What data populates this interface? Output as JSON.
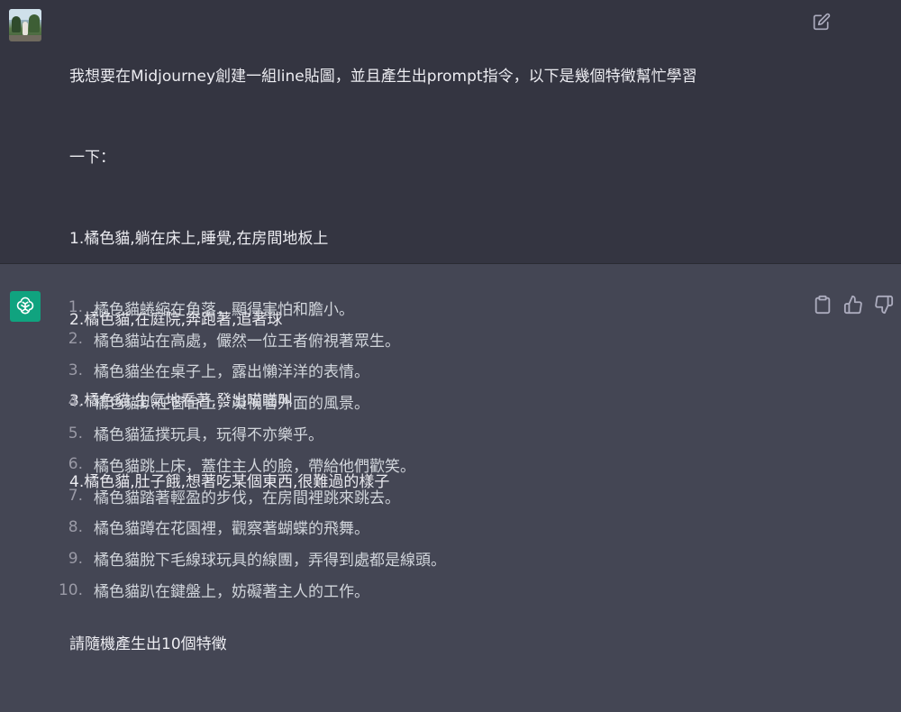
{
  "user_message": {
    "lines": [
      "我想要在Midjourney創建一組line貼圖，並且產生出prompt指令，以下是幾個特徵幫忙學習",
      "一下：",
      "1.橘色貓,躺在床上,睡覺,在房間地板上",
      "2.橘色貓,在庭院,奔跑著,追著球",
      "3.橘色貓,生氣地看著,發出喵喵叫",
      "4.橘色貓,肚子餓,想著吃某個東西,很難過的樣子",
      "請隨機產生出10個特徵"
    ],
    "edit_icon": "pencil-square-icon"
  },
  "assistant_message": {
    "logo_icon": "openai-logo-icon",
    "items": [
      {
        "num": "1.",
        "text": "橘色貓蜷縮在角落，顯得害怕和膽小。"
      },
      {
        "num": "2.",
        "text": "橘色貓站在高處，儼然一位王者俯視著眾生。"
      },
      {
        "num": "3.",
        "text": "橘色貓坐在桌子上，露出懶洋洋的表情。"
      },
      {
        "num": "4.",
        "text": "橘色貓趴在窗台上，凝視著外面的風景。"
      },
      {
        "num": "5.",
        "text": "橘色貓猛撲玩具，玩得不亦樂乎。"
      },
      {
        "num": "6.",
        "text": "橘色貓跳上床，蓋住主人的臉，帶給他們歡笑。"
      },
      {
        "num": "7.",
        "text": "橘色貓踏著輕盈的步伐，在房間裡跳來跳去。"
      },
      {
        "num": "8.",
        "text": "橘色貓蹲在花園裡，觀察著蝴蝶的飛舞。"
      },
      {
        "num": "9.",
        "text": "橘色貓脫下毛線球玩具的線團，弄得到處都是線頭。"
      },
      {
        "num": "10.",
        "text": "橘色貓趴在鍵盤上，妨礙著主人的工作。"
      }
    ],
    "action_icons": [
      "clipboard-icon",
      "thumbs-up-icon",
      "thumbs-down-icon"
    ]
  },
  "colors": {
    "user_bg": "#343541",
    "assistant_bg": "#444654",
    "accent": "#10a37f"
  }
}
